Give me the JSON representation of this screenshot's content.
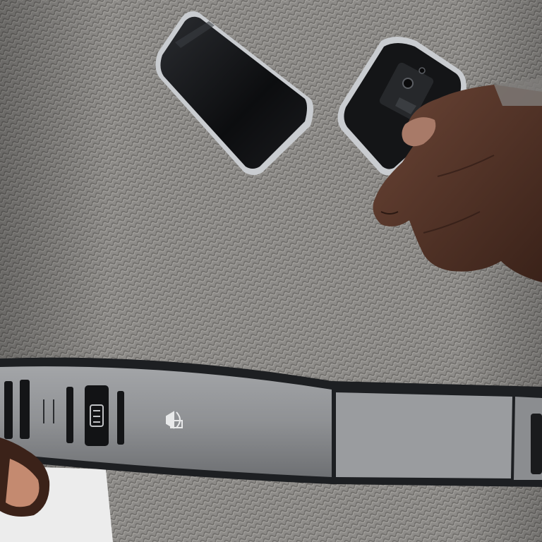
{
  "scene": {
    "subject": "person-in-knit-sweater-holding-devices",
    "colors": {
      "sweater_base": "#8d8b88",
      "sweater_dark": "#6f6d6a",
      "sweater_light": "#a9a7a3",
      "skin": "#4a2f24",
      "skin_highlight": "#7a5444",
      "device_black": "#111214",
      "device_silver": "#c9ccd0",
      "belt_gray": "#8f9194",
      "belt_dark": "#1d1f22",
      "background_light": "#e9e9e9"
    },
    "objects": [
      {
        "name": "black-smartphone"
      },
      {
        "name": "handheld-device-with-camera"
      },
      {
        "name": "right-hand"
      },
      {
        "name": "gray-waist-belt"
      },
      {
        "name": "left-hand"
      }
    ]
  }
}
